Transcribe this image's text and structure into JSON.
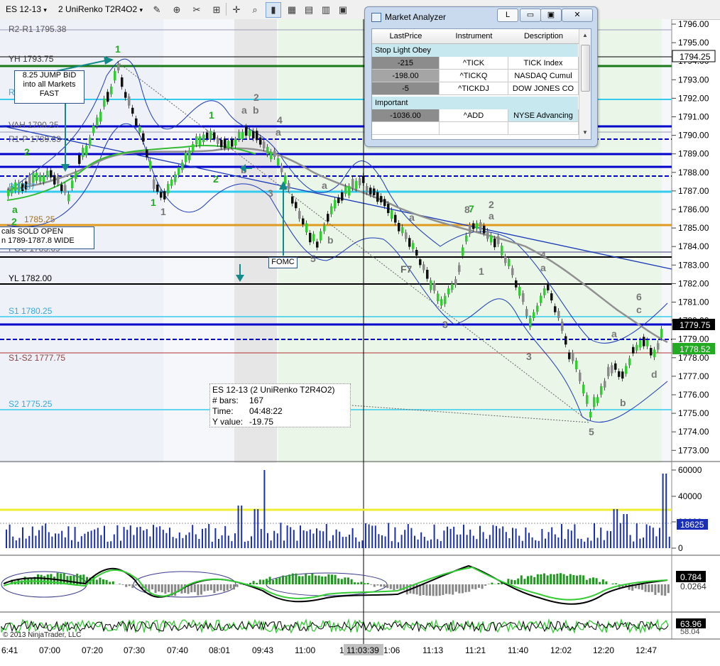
{
  "toolbar": {
    "instrument": "ES 12-13",
    "period": "2 UniRenko T2R4O2",
    "instrument_caret": "▾",
    "period_caret": "▾"
  },
  "analyzer": {
    "title": "Market Analyzer",
    "btn_l": "L",
    "btn_min": "▭",
    "btn_max": "▣",
    "btn_close": "✕",
    "columns": [
      "LastPrice",
      "Instrument",
      "Description"
    ],
    "groups": [
      {
        "name": "Stop Light Obey",
        "rows": [
          {
            "last": "-215",
            "inst": "^TICK",
            "desc": "TICK Index"
          },
          {
            "last": "-198.00",
            "inst": "^TICKQ",
            "desc": "NASDAQ Cumul"
          },
          {
            "last": "-5",
            "inst": "^TICKDJ",
            "desc": "DOW JONES CO"
          }
        ]
      },
      {
        "name": "Important",
        "rows": [
          {
            "last": "-1036.00",
            "inst": "^ADD",
            "desc": "NYSE Advancing"
          }
        ]
      }
    ]
  },
  "levels": {
    "r2r1": "R2-R1 1795.38",
    "yh": "YH 1793.75",
    "r1": "R1 179",
    "vah": "VAH 1790.25",
    "r1p": "R1-P 1789.63",
    "p": "P 1787",
    "p85": "1785.25",
    "poc": "POC 1783.69",
    "yl": "YL 1782.00",
    "s1": "S1 1780.25",
    "s1s2": "S1-S2 1777.75",
    "s2": "S2 1775.25"
  },
  "notes": {
    "jump": [
      "8.25 JUMP BID",
      "into all Markets",
      "FAST"
    ],
    "sold": [
      "cals SOLD OPEN",
      "n 1789-1787.8 WIDE"
    ],
    "fomc": "FOMC",
    "f7": "F7"
  },
  "tooltip": {
    "title": "ES 12-13 (2 UniRenko T2R4O2)",
    "bars_label": "# bars:",
    "bars_value": "167",
    "time_label": "Time:",
    "time_value": "04:48:22",
    "y_label": "Y value:",
    "y_value": "-19.75"
  },
  "price_axis": {
    "ticks": [
      "1796.00",
      "1795.00",
      "1794.00",
      "1793.00",
      "1792.00",
      "1791.00",
      "1790.00",
      "1789.00",
      "1788.00",
      "1787.00",
      "1786.00",
      "1785.00",
      "1784.00",
      "1783.00",
      "1782.00",
      "1781.00",
      "1780.00",
      "1779.00",
      "1778.00",
      "1777.00",
      "1776.00",
      "1775.00",
      "1774.00",
      "1773.00"
    ],
    "badge_yh": "1794.25",
    "badge_last": "1779.75",
    "badge_green": "1778.52"
  },
  "volume_axis": {
    "ticks": [
      "60000",
      "40000",
      "20000",
      "0"
    ],
    "badge": "18625"
  },
  "osc_axis": {
    "badge": "0.784",
    "badge2": "0.0264"
  },
  "osc2_axis": {
    "badge": "63.96",
    "badge2": "58.04"
  },
  "time_axis": {
    "ticks": [
      "6:41",
      "07:00",
      "07:20",
      "07:30",
      "07:40",
      "08:01",
      "09:43",
      "11:00",
      "1",
      "11:03:39",
      "1:06",
      "11:13",
      "11:21",
      "11:40",
      "12:02",
      "12:20",
      "12:47"
    ],
    "cursor": "11:03:39"
  },
  "copyright": "© 2013 NinjaTrader, LLC",
  "wave_labels": [
    "1",
    "2",
    "a",
    "2",
    "1",
    "2",
    "2",
    "1",
    "b",
    "a",
    "b",
    "1",
    "2",
    "a",
    "4",
    "a",
    "3",
    "5",
    "b",
    "a",
    "3",
    "8",
    "2",
    "a",
    "1",
    "7",
    "4",
    "a",
    "3",
    "5",
    "6",
    "c",
    "a",
    "b",
    "d"
  ],
  "colors": {
    "up": "#33cc33",
    "down": "#8a8a8a",
    "blue_line": "#0000cc",
    "cyan_line": "#33ccee",
    "teal_arrow": "#138a8a"
  }
}
